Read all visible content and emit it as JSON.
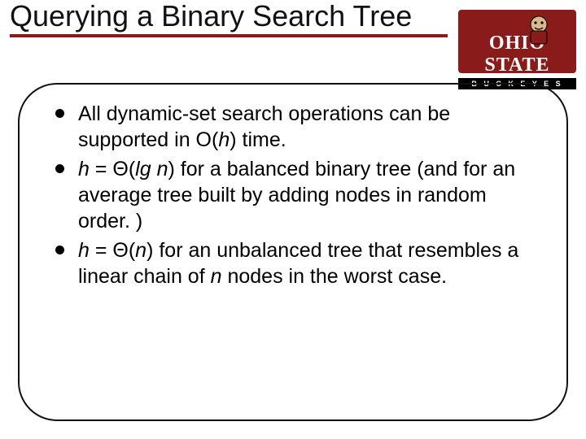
{
  "title": "Querying a Binary Search Tree",
  "logo": {
    "name": "OHIO STATE",
    "subtitle": "B U C K E Y E S"
  },
  "bullets": [
    {
      "pre": "All dynamic-set search operations can be supported in O(",
      "i1": "h",
      "post": ") time."
    },
    {
      "i1": "h",
      "mid1": " = Θ(",
      "i2": "lg n",
      "mid2": ") for a balanced binary tree (and for an average tree built by adding nodes in random order. )"
    },
    {
      "i1": "h",
      "mid1": " = Θ(",
      "i2": "n",
      "mid2": ") for an unbalanced tree that resembles a linear chain of ",
      "i3": "n",
      "post": " nodes in the worst case."
    }
  ]
}
